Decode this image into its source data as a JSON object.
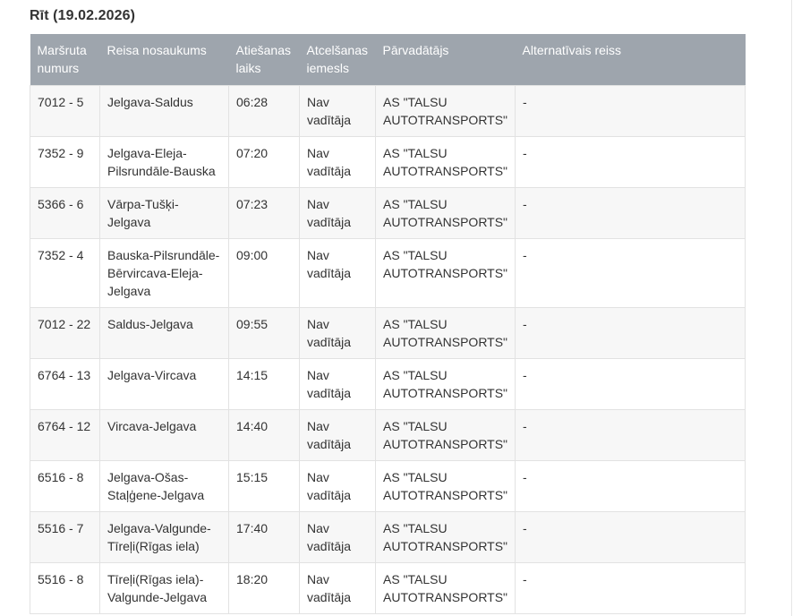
{
  "section": {
    "title": "Rīt (19.02.2026)"
  },
  "table": {
    "headers": [
      "Maršruta numurs",
      "Reisa nosaukums",
      "Atiešanas laiks",
      "Atcelšanas iemesls",
      "Pārvadātājs",
      "Alternatīvais reiss"
    ],
    "rows": [
      {
        "route": "7012 - 5",
        "name": "Jelgava-Saldus",
        "time": "06:28",
        "reason": "Nav vadītāja",
        "carrier": "AS \"TALSU AUTOTRANSPORTS\"",
        "alt": "-"
      },
      {
        "route": "7352 - 9",
        "name": "Jelgava-Eleja-Pilsrundāle-Bauska",
        "time": "07:20",
        "reason": "Nav vadītāja",
        "carrier": "AS \"TALSU AUTOTRANSPORTS\"",
        "alt": "-"
      },
      {
        "route": "5366 - 6",
        "name": "Vārpa-Tušķi-Jelgava",
        "time": "07:23",
        "reason": "Nav vadītāja",
        "carrier": "AS \"TALSU AUTOTRANSPORTS\"",
        "alt": "-"
      },
      {
        "route": "7352 - 4",
        "name": "Bauska-Pilsrundāle-Bērvircava-Eleja-Jelgava",
        "time": "09:00",
        "reason": "Nav vadītāja",
        "carrier": "AS \"TALSU AUTOTRANSPORTS\"",
        "alt": "-"
      },
      {
        "route": "7012 - 22",
        "name": "Saldus-Jelgava",
        "time": "09:55",
        "reason": "Nav vadītāja",
        "carrier": "AS \"TALSU AUTOTRANSPORTS\"",
        "alt": "-"
      },
      {
        "route": "6764 - 13",
        "name": "Jelgava-Vircava",
        "time": "14:15",
        "reason": "Nav vadītāja",
        "carrier": "AS \"TALSU AUTOTRANSPORTS\"",
        "alt": "-"
      },
      {
        "route": "6764 - 12",
        "name": "Vircava-Jelgava",
        "time": "14:40",
        "reason": "Nav vadītāja",
        "carrier": "AS \"TALSU AUTOTRANSPORTS\"",
        "alt": "-"
      },
      {
        "route": "6516 - 8",
        "name": "Jelgava-Ošas-Staļģene-Jelgava",
        "time": "15:15",
        "reason": "Nav vadītāja",
        "carrier": "AS \"TALSU AUTOTRANSPORTS\"",
        "alt": "-"
      },
      {
        "route": "5516 - 7",
        "name": "Jelgava-Valgunde-Tīreļi(Rīgas iela)",
        "time": "17:40",
        "reason": "Nav vadītāja",
        "carrier": "AS \"TALSU AUTOTRANSPORTS\"",
        "alt": "-"
      },
      {
        "route": "5516 - 8",
        "name": "Tīreļi(Rīgas iela)-Valgunde-Jelgava",
        "time": "18:20",
        "reason": "Nav vadītāja",
        "carrier": "AS \"TALSU AUTOTRANSPORTS\"",
        "alt": "-"
      }
    ]
  },
  "colors": {
    "header_bg": "#9ea5ad",
    "header_text": "#ffffff",
    "row_odd_bg": "#f7f7f7",
    "row_even_bg": "#ffffff",
    "border": "#e2e2e2",
    "text": "#333333"
  }
}
